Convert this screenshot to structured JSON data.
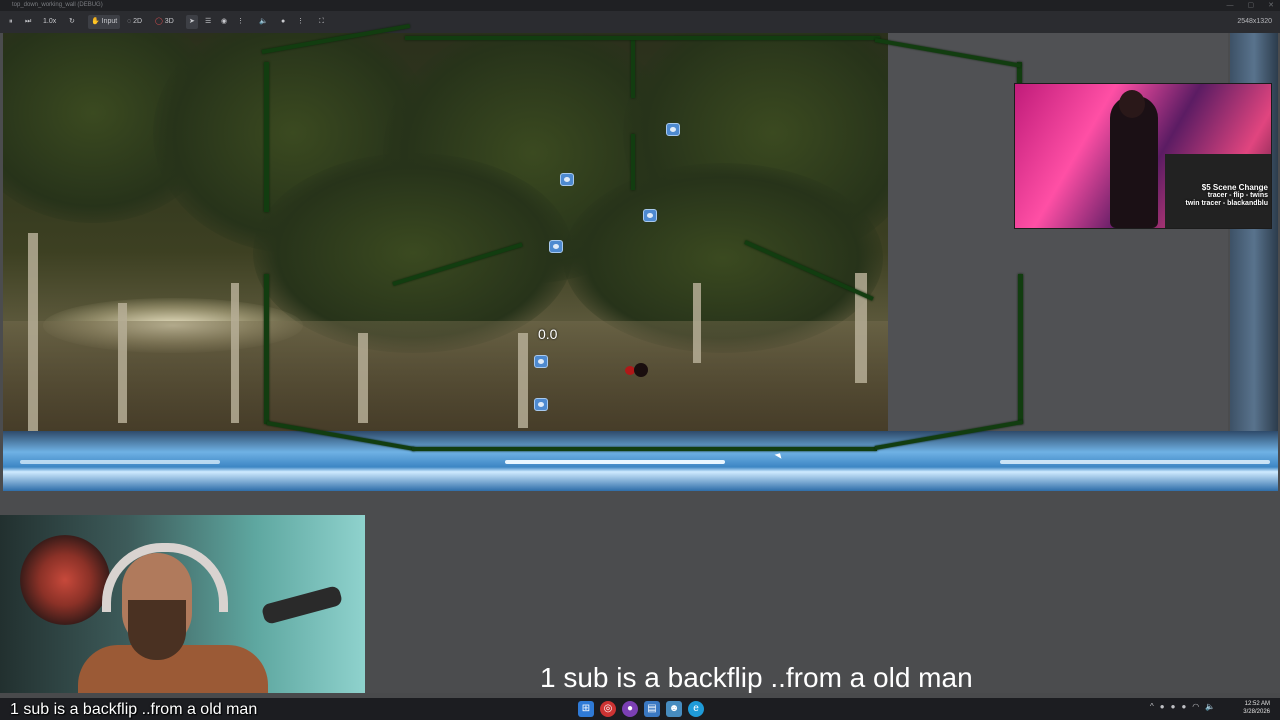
{
  "window": {
    "title": "top_down_working_wall (DEBUG)",
    "controls": [
      "minimize-icon",
      "maximize-icon",
      "close-icon"
    ]
  },
  "toolbar": {
    "items": [
      {
        "name": "pause-icon",
        "label": ""
      },
      {
        "name": "next-frame-icon",
        "label": ""
      },
      {
        "name": "speed",
        "label": "1.0x"
      },
      {
        "name": "reset-icon",
        "label": ""
      },
      {
        "name": "input",
        "label": "Input"
      },
      {
        "name": "2d",
        "label": "2D"
      },
      {
        "name": "3d",
        "label": "3D"
      }
    ],
    "resolution": "2548x1320"
  },
  "game": {
    "score": "0.0"
  },
  "stream": {
    "top_overlay_lines": [
      "$5 Scene Change",
      "tracer - flip - twins",
      "twin tracer - blackandblu"
    ],
    "caption": "1 sub is a backflip ..from a old man",
    "cam_caption": "1 sub is a backflip ..from a old man"
  },
  "taskbar": {
    "apps": [
      "windows-start-icon",
      "chrome-icon",
      "app-icon",
      "explorer-icon",
      "godot-icon",
      "edge-icon"
    ],
    "time": "12:52 AM",
    "date": "3/28/2026"
  },
  "colors": {
    "wall": "#123d10",
    "floor": "#6fb1e4",
    "background": "#494a4c"
  }
}
